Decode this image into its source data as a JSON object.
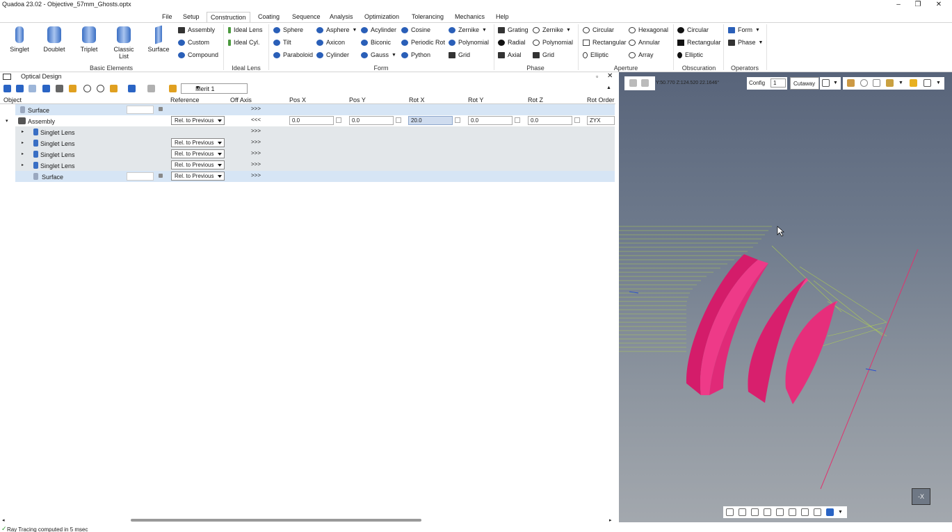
{
  "window": {
    "title": "Quadoa 23.02 - Objective_57mm_Ghosts.optx"
  },
  "menu": [
    "File",
    "Setup",
    "Construction",
    "Coating",
    "Sequence",
    "Analysis",
    "Optimization",
    "Tolerancing",
    "Mechanics",
    "Help"
  ],
  "ribbon": {
    "basic": {
      "singlet": "Singlet",
      "doublet": "Doublet",
      "triplet": "Triplet",
      "classic1": "Classic",
      "classic2": "List",
      "surface": "Surface",
      "assembly": "Assembly",
      "custom": "Custom",
      "compound": "Compound",
      "label": "Basic Elements"
    },
    "ideal": {
      "lens": "Ideal Lens",
      "cyl": "Ideal Cyl.",
      "label": "Ideal Lens"
    },
    "form": {
      "sphere": "Sphere",
      "tilt": "Tilt",
      "paraboloid": "Paraboloid",
      "asphere": "Asphere",
      "axicon": "Axicon",
      "cylinder": "Cylinder",
      "acylinder": "Acylinder",
      "biconic": "Biconic",
      "gauss": "Gauss",
      "cosine": "Cosine",
      "periodic": "Periodic Rot",
      "python": "Python",
      "zernike": "Zernike",
      "polynomial": "Polynomial",
      "grid": "Grid",
      "label": "Form"
    },
    "phase": {
      "grating": "Grating",
      "radial": "Radial",
      "axial": "Axial",
      "zernike": "Zernike",
      "polynomial": "Polynomial",
      "grid": "Grid",
      "label": "Phase"
    },
    "aperture": {
      "circular": "Circular",
      "rectangular": "Rectangular",
      "elliptic": "Elliptic",
      "hexagonal": "Hexagonal",
      "annular": "Annular",
      "array": "Array",
      "label": "Aperture"
    },
    "obscuration": {
      "circular": "Circular",
      "rectangular": "Rectangular",
      "elliptic": "Elliptic",
      "label": "Obscuration"
    },
    "operators": {
      "form": "Form",
      "phase": "Phase",
      "label": "Operators"
    }
  },
  "panel": {
    "title": "Optical Design",
    "merit": "Merit 1"
  },
  "table": {
    "headers": [
      "Object",
      "Reference",
      "Off Axis",
      "Pos X",
      "Pos Y",
      "Rot X",
      "Rot Y",
      "Rot Z",
      "Rot Order"
    ],
    "rows": [
      {
        "name": "Surface",
        "ref": "",
        "off": ">>>"
      },
      {
        "name": "Assembly",
        "ref": "Rel. to Previous",
        "off": "<<<",
        "posx": "0.0",
        "posy": "0.0",
        "rotx": "20.0",
        "roty": "0.0",
        "rotz": "0.0",
        "order": "ZYX"
      },
      {
        "name": "Singlet Lens",
        "ref": "",
        "off": ">>>"
      },
      {
        "name": "Singlet Lens",
        "ref": "Rel. to Previous",
        "off": ">>>"
      },
      {
        "name": "Singlet Lens",
        "ref": "Rel. to Previous",
        "off": ">>>"
      },
      {
        "name": "Singlet Lens",
        "ref": "Rel. to Previous",
        "off": ">>>"
      },
      {
        "name": "Surface",
        "ref": "Rel. to Previous",
        "off": ">>>"
      }
    ]
  },
  "view": {
    "coords": "Y:50.770 Z:124.520 22.1646°",
    "config_label": "Config",
    "config_value": "1",
    "mode": "Cutaway",
    "axis_label": "-X"
  },
  "status": "Ray Tracing computed in 5 msec",
  "colors": {
    "lens": "#e8337d",
    "rays": "#b5d64a",
    "chief": "#e0336e"
  }
}
